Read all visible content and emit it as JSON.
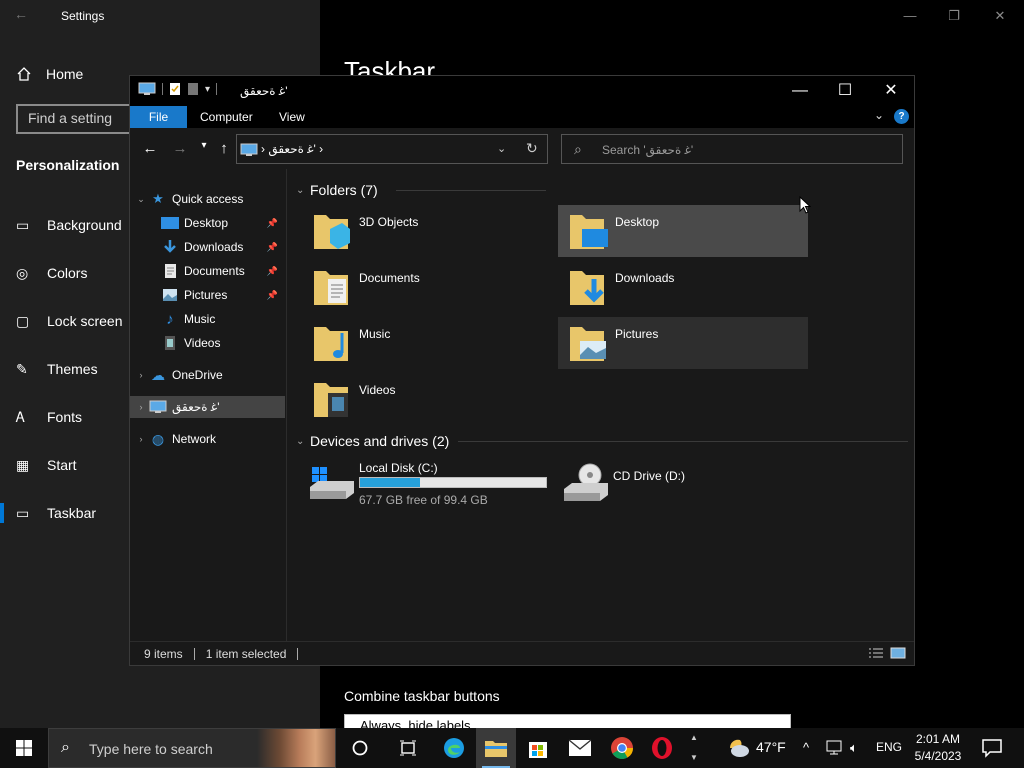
{
  "settings": {
    "title": "Settings",
    "home": "Home",
    "search_placeholder": "Find a setting",
    "section": "Personalization",
    "nav": [
      "Background",
      "Colors",
      "Lock screen",
      "Themes",
      "Fonts",
      "Start",
      "Taskbar"
    ],
    "active_nav": "Taskbar",
    "heading": "Taskbar",
    "combine_label": "Combine taskbar buttons",
    "combine_value": "Always, hide labels"
  },
  "explorer": {
    "title": "ﻏ ﺓﺣﻌﻘﻖ'",
    "ribbon_tabs": [
      "File",
      "Computer",
      "View"
    ],
    "address": "ﻏ ﺓﺣﻌﻘﻖ'",
    "search_placeholder": "Search 'ﻏ ﺓﺣﻌﻘﻖ'",
    "tree": {
      "quick_access": "Quick access",
      "quick_items": [
        "Desktop",
        "Downloads",
        "Documents",
        "Pictures",
        "Music",
        "Videos"
      ],
      "onedrive": "OneDrive",
      "this_pc": "ﻏ ﺓﺣﻌﻘﻖ'",
      "network": "Network"
    },
    "folders_header": "Folders (7)",
    "folders": [
      "3D Objects",
      "Desktop",
      "Documents",
      "Downloads",
      "Music",
      "Pictures",
      "Videos"
    ],
    "devices_header": "Devices and drives (2)",
    "drives": [
      {
        "name": "Local Disk (C:)",
        "free": "67.7 GB free of 99.4 GB",
        "used_fraction": 0.32
      },
      {
        "name": "CD Drive (D:)"
      }
    ],
    "status": {
      "items": "9 items",
      "selected": "1 item selected"
    }
  },
  "taskbar": {
    "search_placeholder": "Type here to search",
    "weather": "47°F",
    "language": "ENG",
    "time": "2:01 AM",
    "date": "5/4/2023"
  },
  "colors": {
    "accent": "#0078d7",
    "ribbon_file": "#1979ca",
    "drive_bar": "#26a0da",
    "folder": "#e8c66a"
  }
}
